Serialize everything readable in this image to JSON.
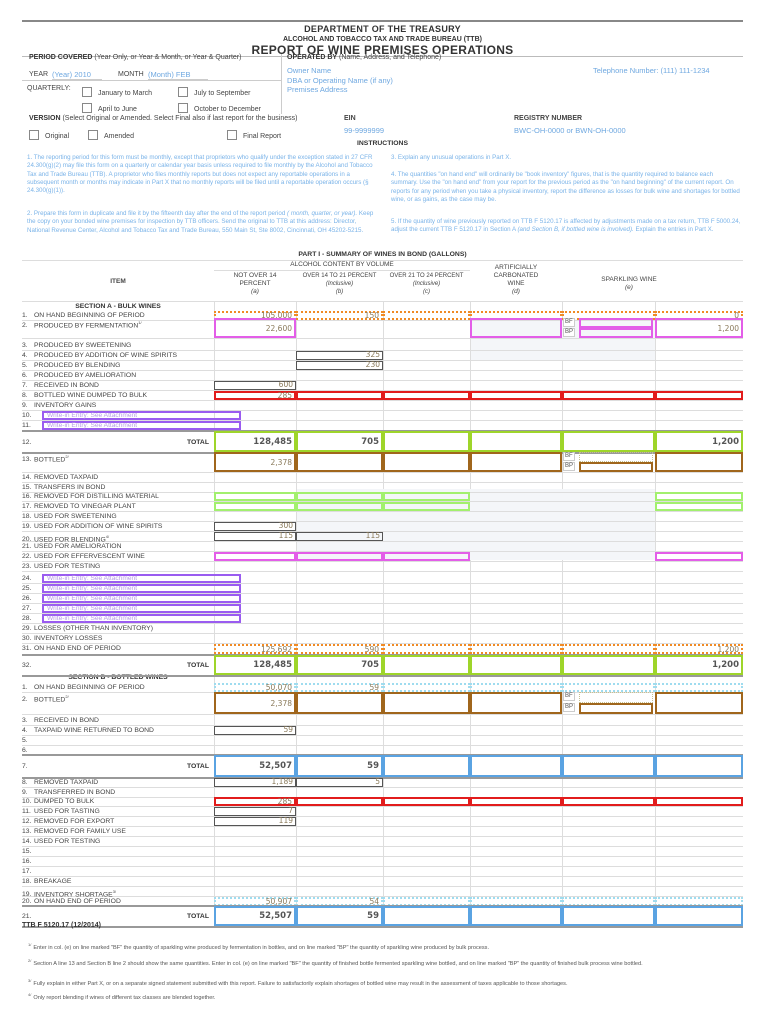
{
  "header": {
    "department": "DEPARTMENT OF THE TREASURY",
    "bureau": "ALCOHOL AND TOBACCO TAX AND TRADE BUREAU (TTB)",
    "title": "REPORT OF WINE PREMISES OPERATIONS"
  },
  "period": {
    "label": "PERIOD COVERED",
    "hint": "(Year Only, or Year & Month, or Year & Quarter)",
    "year_label": "YEAR",
    "year_value": "(Year) 2010",
    "month_label": "MONTH",
    "month_value": "(Month) FEB",
    "quarterly_label": "QUARTERLY:",
    "quarters": [
      "January to March",
      "July to September",
      "April to June",
      "October to December"
    ]
  },
  "operated_by": {
    "label": "OPERATED BY",
    "hint": "(Name, Address, and Telephone)",
    "owner": "Owner Name",
    "dba": "DBA or Operating Name (if any)",
    "address": "Premises Address",
    "telephone": "Telephone Number: (111) 111-1234"
  },
  "version": {
    "label": "VERSION",
    "hint": "(Select Original or Amended.  Select Final also if last report for the business)",
    "options": [
      "Original",
      "Amended",
      "Final Report"
    ]
  },
  "ein": {
    "label": "EIN",
    "value": "99-9999999"
  },
  "registry": {
    "label": "REGISTRY NUMBER",
    "value": "BWC-OH-0000 or BWN-OH-0000"
  },
  "instructions": {
    "title": "INSTRUCTIONS",
    "i1": "1.  The reporting period for this form must be monthly, except that proprietors who qualify under the exception stated in 27 CFR 24.300(g)(2) may file this form on a quarterly or calendar year basis unless required to file monthly by the Alcohol and Tobacco Tax and Trade Bureau (TTB). A proprietor who files monthly reports but does not expect any reportable operations in a subsequent month or months may indicate in Part X that no monthly reports will be filed until a reportable operation occurs  (§ 24.300(g)(1)).",
    "i2a": "2.  Prepare this form in duplicate and file it by the fifteenth day after the end of the report period",
    "i2b": "( month, quarter, or year).",
    "i2c": " Keep the copy on your bonded wine premises for inspection by TTB officers. Send the original to TTB at this address: Director, National Revenue Center, Alcohol and Tobacco Tax and Trade Bureau, 550 Main St, Ste 8002, Cincinnati, OH 45202-5215.",
    "i3": "3.  Explain any unusual operations in Part X.",
    "i4": "4.  The quantities \"on hand end\" will ordinarily be \"book inventory\" figures, that is the quantity required to balance each summary. Use the \"on hand end\" from your report for the previous period as the \"on hand beginning\" of the current report.  On reports for any period when you take a physical inventory, report the difference as losses for bulk wine and shortages for bottled wine, or as gains, as the case may be.",
    "i5a": "5.  If the quantity of wine previously reported on TTB F 5120.17 is affected by adjustments made on a tax return, TTB F 5000.24, adjust the current TTB F 5120.17 in Section A",
    "i5b": "(and Section B, if bottled wine is involved).",
    "i5c": "  Explain the entries in Part X."
  },
  "part1": {
    "title": "PART I - SUMMARY OF WINES IN BOND (GALLONS)",
    "alcohol_header": "ALCOHOL CONTENT BY VOLUME",
    "item_header": "ITEM",
    "columns": [
      {
        "l1": "NOT OVER 14",
        "l2": "PERCENT",
        "l3": "(a)"
      },
      {
        "l1": "OVER 14 TO 21 PERCENT",
        "l2": "(Inclusive)",
        "l3": "(b)"
      },
      {
        "l1": "OVER 21 TO 24 PERCENT",
        "l2": "(Inclusive)",
        "l3": "(c)"
      },
      {
        "l1": "ARTIFICIALLY",
        "l2": "CARBONATED",
        "l3": "WINE",
        "l4": "(d)"
      },
      {
        "l1": "SPARKLING WINE",
        "l2": "(e)"
      }
    ],
    "bf": "BF",
    "bp": "BP",
    "total_label": "TOTAL",
    "section_a": {
      "title": "SECTION A - BULK WINES",
      "rows": [
        {
          "n": "1.",
          "label": "ON HAND BEGINNING OF PERIOD",
          "a": "105,000",
          "b": "150",
          "e2": "0"
        },
        {
          "n": "2.",
          "label": "PRODUCED BY FERMENTATION",
          "sup": "1/",
          "a": "22,600",
          "e2": "1,200"
        },
        {
          "n": "3.",
          "label": "PRODUCED BY SWEETENING"
        },
        {
          "n": "4.",
          "label": "PRODUCED BY ADDITION OF WINE SPIRITS",
          "b": "325"
        },
        {
          "n": "5.",
          "label": "PRODUCED BY BLENDING",
          "b": "230"
        },
        {
          "n": "6.",
          "label": "PRODUCED BY AMELIORATION"
        },
        {
          "n": "7.",
          "label": "RECEIVED IN BOND",
          "a": "600"
        },
        {
          "n": "8.",
          "label": "BOTTLED WINE DUMPED TO BULK",
          "a": "285"
        },
        {
          "n": "9.",
          "label": "INVENTORY GAINS"
        },
        {
          "n": "10.",
          "label": "Write-in Entry:  See Attachment"
        },
        {
          "n": "11.",
          "label": "Write-in Entry:  See Attachment"
        },
        {
          "n": "12.",
          "label": "TOTAL",
          "a": "128,485",
          "b": "705",
          "e2": "1,200"
        },
        {
          "n": "13.",
          "label": "BOTTLED",
          "sup": "2/",
          "a": "2,378"
        },
        {
          "n": "14.",
          "label": "REMOVED TAXPAID"
        },
        {
          "n": "15.",
          "label": "TRANSFERS IN BOND"
        },
        {
          "n": "16.",
          "label": "REMOVED FOR DISTILLING MATERIAL"
        },
        {
          "n": "17.",
          "label": "REMOVED TO VINEGAR PLANT"
        },
        {
          "n": "18.",
          "label": "USED FOR SWEETENING"
        },
        {
          "n": "19.",
          "label": "USED FOR ADDITION OF WINE SPIRITS",
          "a": "300"
        },
        {
          "n": "20.",
          "label": "USED FOR BLENDING",
          "sup": "4/",
          "a": "115",
          "b": "115"
        },
        {
          "n": "21.",
          "label": "USED FOR AMELIORATION"
        },
        {
          "n": "22.",
          "label": "USED FOR EFFERVESCENT WINE"
        },
        {
          "n": "23.",
          "label": "USED FOR TESTING"
        },
        {
          "n": "24.",
          "label": "Write-in Entry:  See Attachment"
        },
        {
          "n": "25.",
          "label": "Write-in Entry:  See Attachment"
        },
        {
          "n": "26.",
          "label": "Write-in Entry:  See Attachment"
        },
        {
          "n": "27.",
          "label": "Write-in Entry:  See Attachment"
        },
        {
          "n": "28.",
          "label": "Write-in Entry:  See Attachment"
        },
        {
          "n": "29.",
          "label": "LOSSES  (OTHER THAN INVENTORY)"
        },
        {
          "n": "30.",
          "label": "INVENTORY LOSSES"
        },
        {
          "n": "31.",
          "label": "ON HAND END OF PERIOD",
          "a": "125,692",
          "b": "590",
          "e2": "1,200"
        },
        {
          "n": "32.",
          "label": "TOTAL",
          "a": "128,485",
          "b": "705",
          "e2": "1,200"
        }
      ]
    },
    "section_b": {
      "title": "SECTION B - BOTTLED  WINES",
      "rows": [
        {
          "n": "1.",
          "label": "ON HAND BEGINNING OF PERIOD",
          "a": "50,070",
          "b": "59"
        },
        {
          "n": "2.",
          "label": "BOTTLED",
          "sup": "2/",
          "a": "2,378"
        },
        {
          "n": "3.",
          "label": "RECEIVED IN BOND"
        },
        {
          "n": "4.",
          "label": "TAXPAID WINE RETURNED TO BOND",
          "a": "59"
        },
        {
          "n": "5.",
          "label": ""
        },
        {
          "n": "6.",
          "label": ""
        },
        {
          "n": "7.",
          "label": "TOTAL",
          "a": "52,507",
          "b": "59"
        },
        {
          "n": "8.",
          "label": "REMOVED TAXPAID",
          "a": "1,189",
          "b": "5"
        },
        {
          "n": "9.",
          "label": "TRANSFERRED IN BOND"
        },
        {
          "n": "10.",
          "label": "DUMPED TO BULK",
          "a": "285"
        },
        {
          "n": "11.",
          "label": "USED FOR TASTING",
          "a": "7"
        },
        {
          "n": "12.",
          "label": "REMOVED FOR EXPORT",
          "a": "119"
        },
        {
          "n": "13.",
          "label": "REMOVED FOR FAMILY USE"
        },
        {
          "n": "14.",
          "label": "USED FOR TESTING"
        },
        {
          "n": "15.",
          "label": ""
        },
        {
          "n": "16.",
          "label": ""
        },
        {
          "n": "17.",
          "label": ""
        },
        {
          "n": "18.",
          "label": "BREAKAGE"
        },
        {
          "n": "19.",
          "label": "INVENTORY SHORTAGE",
          "sup": "3/"
        },
        {
          "n": "20.",
          "label": "ON HAND END OF PERIOD",
          "a": "50,907",
          "b": "54"
        },
        {
          "n": "21.",
          "label": "TOTAL",
          "a": "52,507",
          "b": "59"
        }
      ]
    }
  },
  "form_id": "TTB F 5120.17 (12/2014)",
  "footnotes": [
    {
      "mark": "1/",
      "text": "Enter in col. (e) on line marked \"BF\" the quantity of sparkling wine produced by fermentation in bottles, and on line marked \"BP\" the quantity of sparkling wine produced by bulk process."
    },
    {
      "mark": "2/",
      "text": "Section A line 13 and Section B line 2 should show the same quantities.  Enter in col. (e) on line marked \"BF\" the quantity of finished bottle fermented sparkling wine bottled, and on line marked \"BP\" the quantity of finished bulk process wine bottled."
    },
    {
      "mark": "3/",
      "text": "Fully explain in either Part X, or on a separate signed statement submitted with this report.  Failure to satisfactorily explain shortages of bottled wine may result in the assessment of taxes applicable to those shortages."
    },
    {
      "mark": "4/",
      "text": "Only report blending if wines of different tax classes are blended together."
    }
  ]
}
